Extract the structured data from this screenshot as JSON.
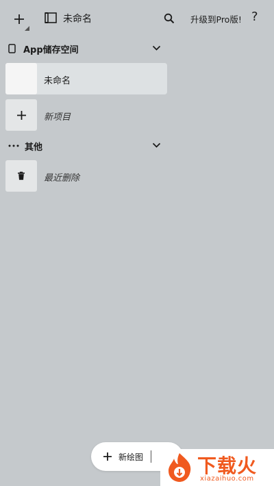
{
  "toolbar": {
    "add_icon": "plus-icon",
    "sidebar_icon": "sidebar-toggle-icon",
    "title": "未命名",
    "search_icon": "search-icon",
    "upgrade_label": "升级到Pro版!",
    "help_label": "?"
  },
  "sections": {
    "storage": {
      "label": "App储存空间",
      "icon": "phone-icon",
      "chevron": "chevron-down-icon"
    },
    "other": {
      "label": "其他",
      "icon": "more-icon",
      "chevron": "chevron-down-icon"
    }
  },
  "projects": [
    {
      "label": "未命名",
      "selected": true
    },
    {
      "label": "新项目",
      "icon": "plus-icon"
    }
  ],
  "other_items": [
    {
      "label": "最近删除",
      "icon": "trash-icon"
    }
  ],
  "bottom": {
    "new_drawing_label": "新绘图",
    "plus_icon": "plus-icon"
  },
  "watermark": {
    "logo_text": "下载火",
    "url": "xiazaihuo.com"
  },
  "colors": {
    "background": "#c5c9cc",
    "selected_row": "#dde1e3",
    "thumb_light": "#f5f5f5",
    "thumb_dark": "#e4e6e7",
    "watermark_orange": "#f05a1f"
  }
}
